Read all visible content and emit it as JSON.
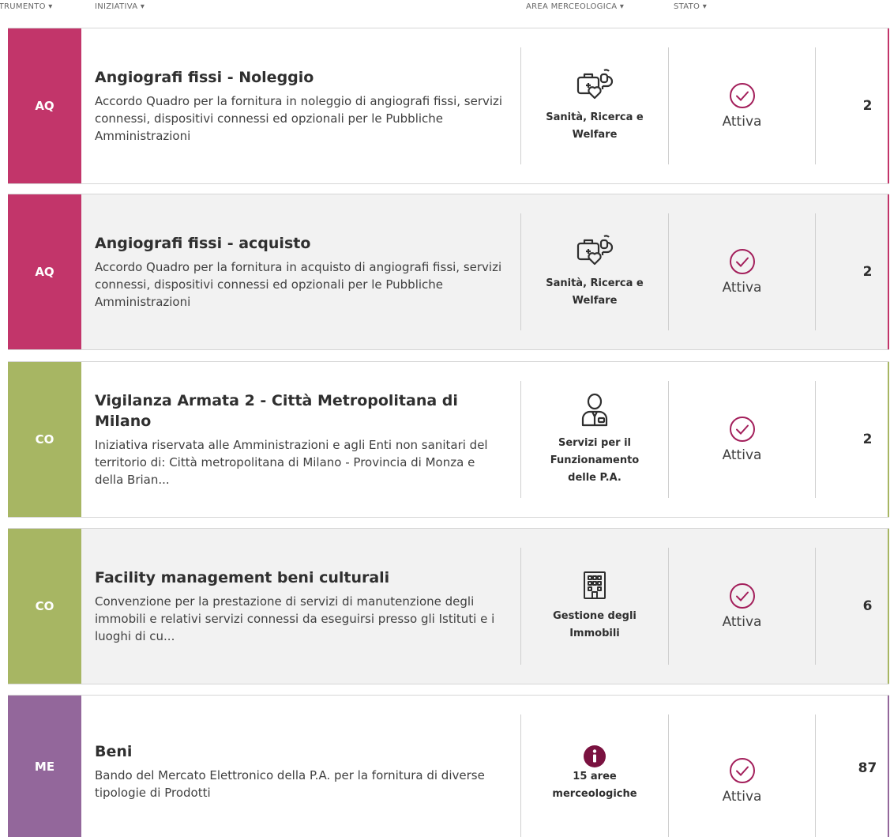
{
  "header": {
    "strumento": "STRUMENTO ▾",
    "iniziativa": "INIZIATIVA ▾",
    "area": "AREA MERCEOLOGICA ▾",
    "stato": "STATO ▾"
  },
  "colors": {
    "AQ": "#c2356a",
    "CO": "#a7b663",
    "ME": "#93679b",
    "accent": "#a31f5b",
    "info_icon": "#7a1240"
  },
  "rows": [
    {
      "tag": "AQ",
      "title": "Angiografi fissi - Noleggio",
      "description": "Accordo Quadro per la fornitura in noleggio di angiografi fissi, servizi connessi, dispositivi connessi ed opzionali per le Pubbliche Amministrazioni",
      "area_icon": "medical-kit-heart-icon",
      "area_label": "Sanità, Ricerca e Welfare",
      "status": "Attiva",
      "count": "2"
    },
    {
      "tag": "AQ",
      "title": "Angiografi fissi - acquisto",
      "description": "Accordo Quadro per la fornitura in acquisto di angiografi fissi, servizi connessi, dispositivi connessi ed opzionali per le Pubbliche Amministrazioni",
      "area_icon": "medical-kit-heart-icon",
      "area_label": "Sanità, Ricerca e Welfare",
      "status": "Attiva",
      "count": "2"
    },
    {
      "tag": "CO",
      "title": "Vigilanza Armata 2 - Città Metropolitana di Milano",
      "description": "Iniziativa riservata alle Amministrazioni e agli Enti non sanitari del territorio di: Città metropolitana di Milano - Provincia di Monza e della Brian...",
      "area_icon": "person-badge-icon",
      "area_label": "Servizi per il Funzionamento delle P.A.",
      "status": "Attiva",
      "count": "2"
    },
    {
      "tag": "CO",
      "title": "Facility management beni culturali",
      "description": "Convenzione per la prestazione di servizi di manutenzione degli immobili e relativi servizi connessi da eseguirsi presso gli Istituti e i luoghi di cu...",
      "area_icon": "building-icon",
      "area_label": "Gestione degli Immobili",
      "status": "Attiva",
      "count": "6"
    },
    {
      "tag": "ME",
      "title": "Beni",
      "description": "Bando del Mercato Elettronico della P.A. per la fornitura di diverse tipologie di Prodotti",
      "area_icon": "info-icon",
      "area_label": "15 aree merceologiche",
      "status": "Attiva",
      "count": "87"
    }
  ]
}
